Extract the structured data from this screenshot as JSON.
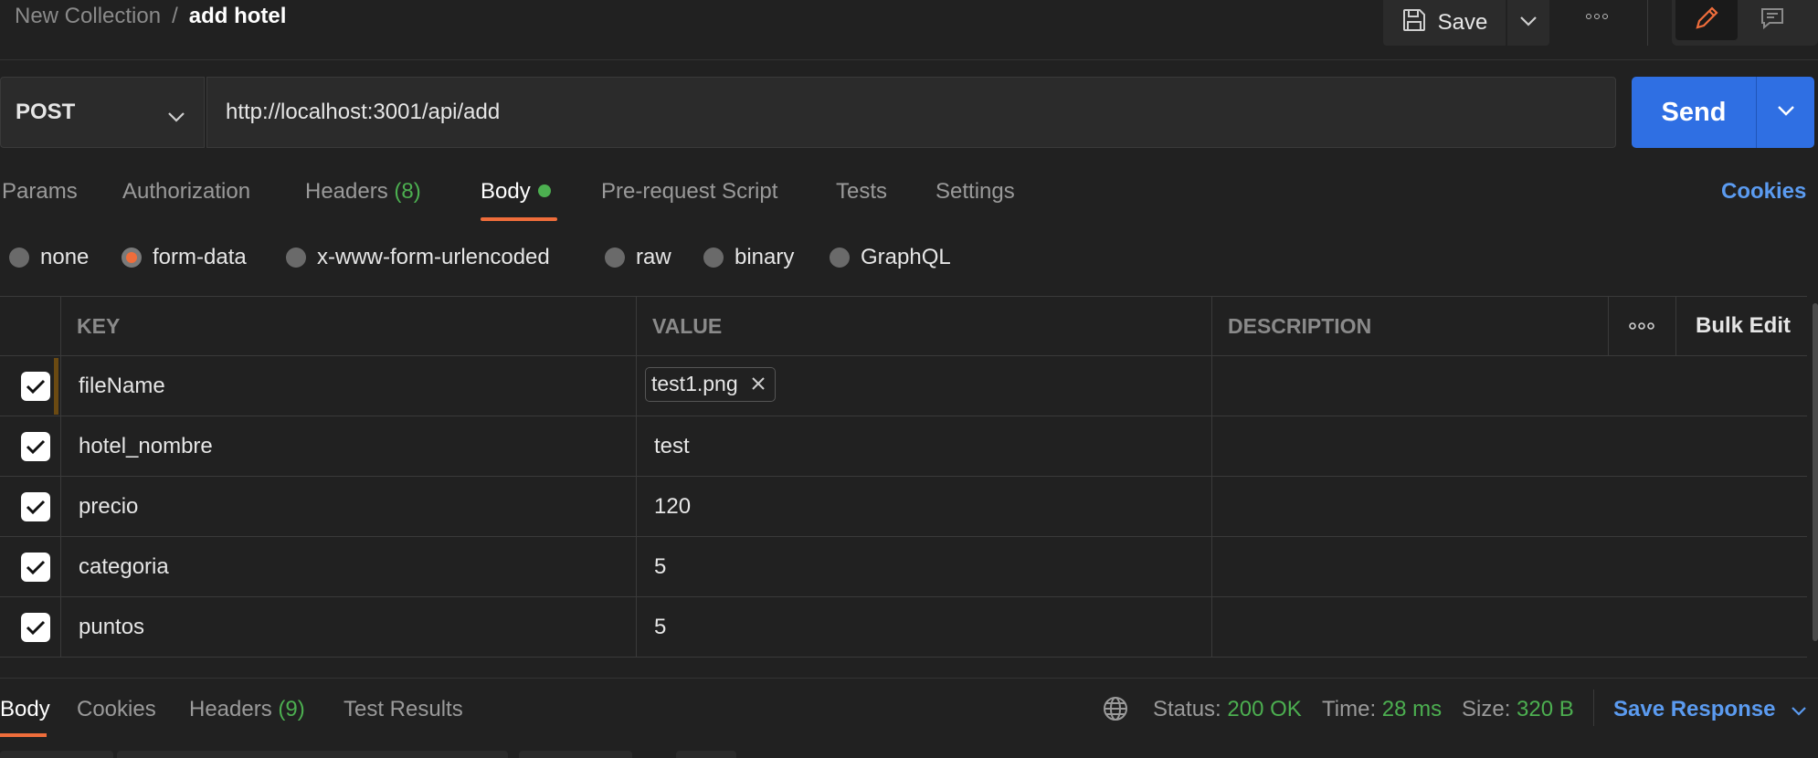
{
  "header": {
    "breadcrumb_parent": "New Collection",
    "breadcrumb_sep": "/",
    "breadcrumb_current": "add hotel",
    "save_label": "Save"
  },
  "request": {
    "method": "POST",
    "url": "http://localhost:3001/api/add",
    "send_label": "Send"
  },
  "tabs": [
    {
      "label": "Params"
    },
    {
      "label": "Authorization"
    },
    {
      "label": "Headers",
      "count": "(8)"
    },
    {
      "label": "Body",
      "active": true
    },
    {
      "label": "Pre-request Script"
    },
    {
      "label": "Tests"
    },
    {
      "label": "Settings"
    }
  ],
  "cookies_label": "Cookies",
  "body_types": [
    "none",
    "form-data",
    "x-www-form-urlencoded",
    "raw",
    "binary",
    "GraphQL"
  ],
  "body_type_selected": "form-data",
  "table": {
    "headers": {
      "key": "KEY",
      "value": "VALUE",
      "description": "DESCRIPTION",
      "bulk_edit": "Bulk Edit"
    },
    "rows": [
      {
        "key": "fileName",
        "value": "test1.png",
        "is_file": true,
        "checked": true
      },
      {
        "key": "hotel_nombre",
        "value": "test",
        "checked": true
      },
      {
        "key": "precio",
        "value": "120",
        "checked": true
      },
      {
        "key": "categoria",
        "value": "5",
        "checked": true
      },
      {
        "key": "puntos",
        "value": "5",
        "checked": true
      }
    ]
  },
  "response": {
    "tabs": [
      {
        "label": "Body",
        "active": true
      },
      {
        "label": "Cookies"
      },
      {
        "label": "Headers",
        "count": "(9)"
      },
      {
        "label": "Test Results"
      }
    ],
    "status_label": "Status:",
    "status_value": "200 OK",
    "time_label": "Time:",
    "time_value": "28 ms",
    "size_label": "Size:",
    "size_value": "320 B",
    "save_response_label": "Save Response"
  },
  "colors": {
    "accent": "#ef6d3b",
    "send": "#2f6fe3",
    "link": "#5b9bf0",
    "success": "#4caf50",
    "background": "#212121"
  },
  "icons": [
    "save-icon",
    "chevron-down-icon",
    "more-icon",
    "pencil-icon",
    "comment-icon",
    "globe-icon",
    "close-icon",
    "checkmark-icon"
  ]
}
